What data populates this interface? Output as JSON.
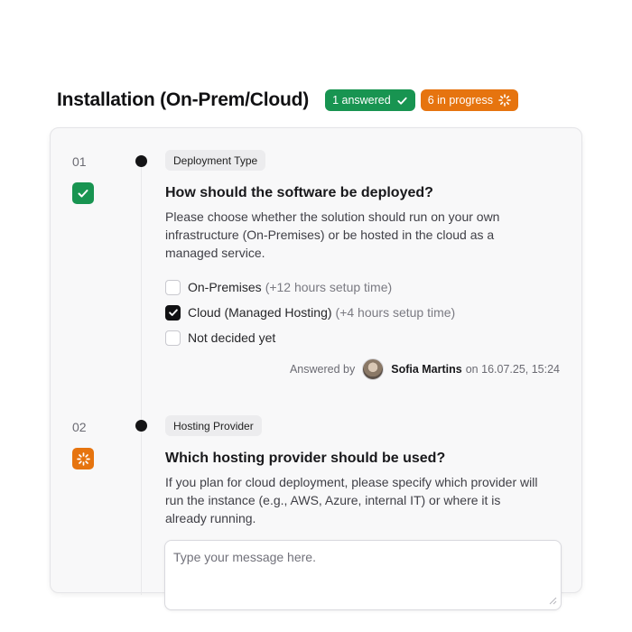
{
  "header": {
    "title": "Installation (On-Prem/Cloud)",
    "answered_badge": "1 answered",
    "progress_badge": "6 in progress",
    "answered_color": "#189451",
    "progress_color": "#e6740f"
  },
  "questions": [
    {
      "number": "01",
      "status": "answered",
      "status_icon": "check-icon",
      "tag": "Deployment Type",
      "title": "How should the software be deployed?",
      "description": "Please choose whether the solution should run on your own infrastructure (On-Premises) or be hosted in the cloud as a managed service.",
      "options": [
        {
          "label": "On-Premises",
          "note": "(+12 hours setup time)",
          "checked": false
        },
        {
          "label": "Cloud (Managed Hosting)",
          "note": "(+4 hours setup time)",
          "checked": true
        },
        {
          "label": "Not decided yet",
          "note": "",
          "checked": false
        }
      ],
      "answered_prefix": "Answered by",
      "answered_by": "Sofia Martins",
      "answered_on": "on 16.07.25, 15:24"
    },
    {
      "number": "02",
      "status": "in progress",
      "status_icon": "spinner-icon",
      "tag": "Hosting Provider",
      "title": "Which hosting provider should be used?",
      "description": "If you plan for cloud deployment, please specify which provider will run the instance (e.g., AWS, Azure, internal IT) or where it is already running.",
      "input_placeholder": "Type your message here."
    }
  ]
}
